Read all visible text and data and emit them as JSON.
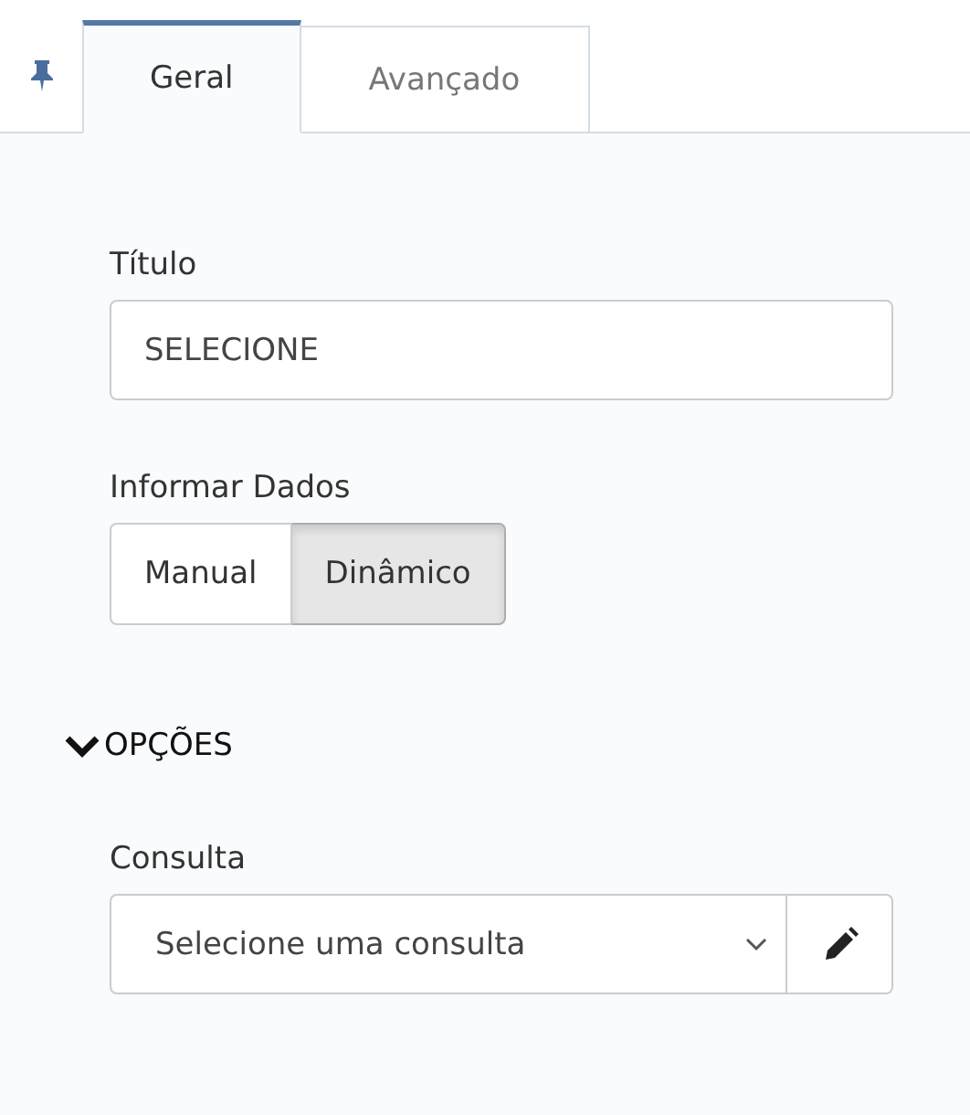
{
  "tabs": [
    {
      "label": "Geral",
      "selected": true
    },
    {
      "label": "Avançado",
      "selected": false
    }
  ],
  "titulo": {
    "label": "Título",
    "value": "SELECIONE"
  },
  "informar_dados": {
    "label": "Informar Dados",
    "options": [
      {
        "label": "Manual",
        "selected": false
      },
      {
        "label": "Dinâmico",
        "selected": true
      }
    ]
  },
  "section": {
    "title": "OPÇÕES",
    "expanded": true
  },
  "consulta": {
    "label": "Consulta",
    "value": "Selecione uma consulta"
  }
}
